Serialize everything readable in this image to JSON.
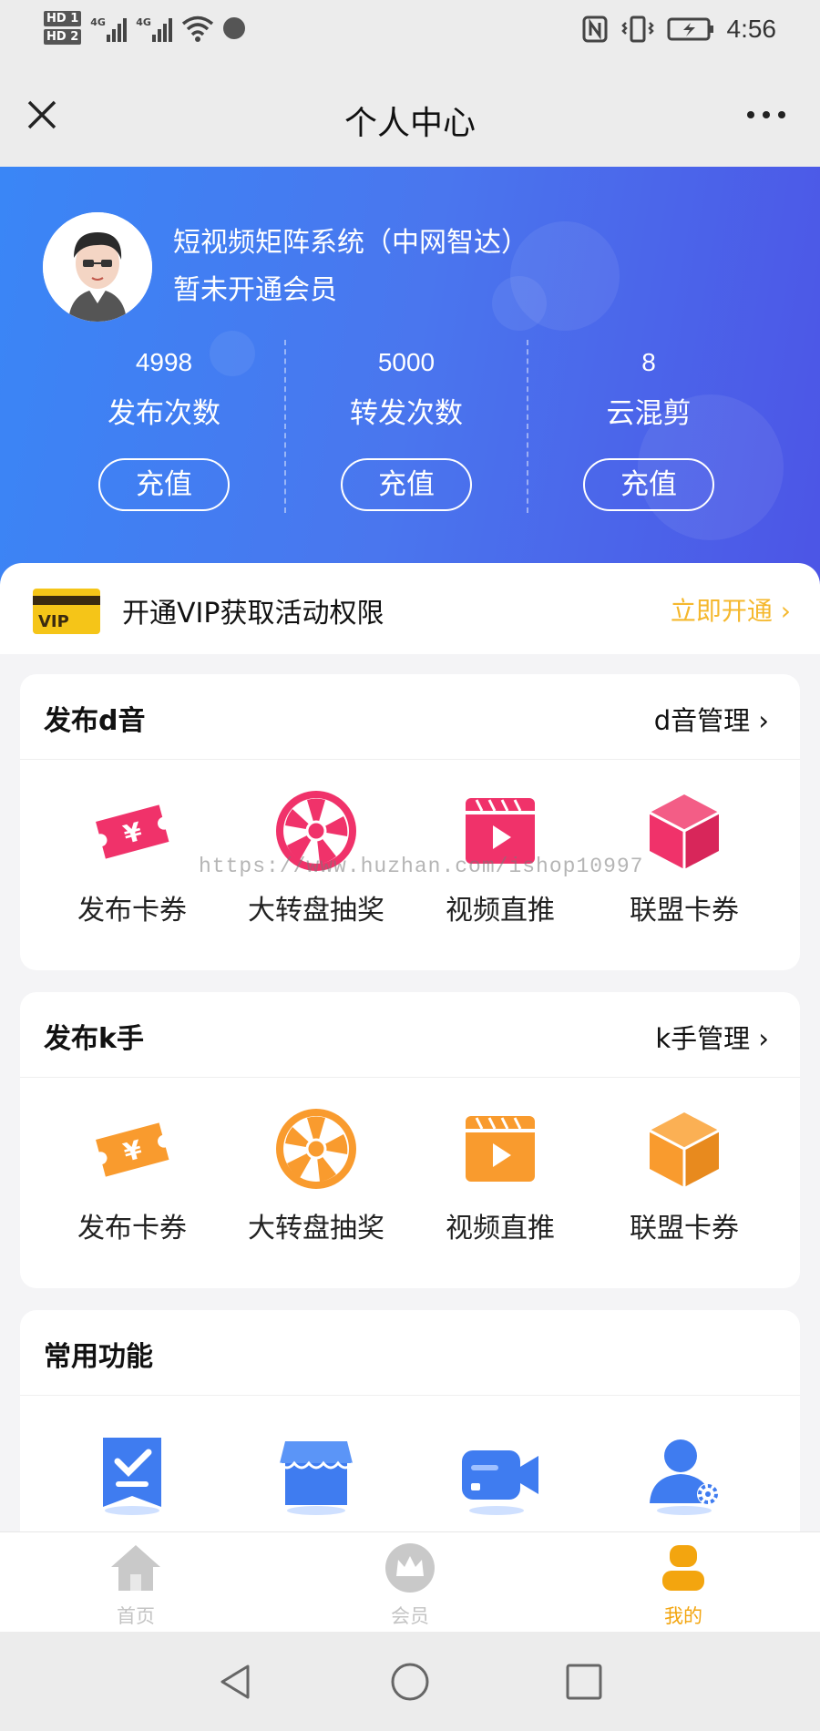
{
  "status_bar": {
    "hd1": "HD 1",
    "hd2": "HD 2",
    "net1": "4G",
    "net2": "4G",
    "time": "4:56"
  },
  "header": {
    "title": "个人中心"
  },
  "profile": {
    "nickname": "短视频矩阵系统（中网智达）",
    "membership": "暂未开通会员",
    "stats": [
      {
        "value": "4998",
        "label": "发布次数",
        "button": "充值"
      },
      {
        "value": "5000",
        "label": "转发次数",
        "button": "充值"
      },
      {
        "value": "8",
        "label": "云混剪",
        "button": "充值"
      }
    ]
  },
  "vip": {
    "badge": "VIP",
    "text": "开通VIP获取活动权限",
    "action": "立即开通 ›"
  },
  "sections": [
    {
      "title": "发布d音",
      "manage": "d音管理 ›",
      "accent": "#f0326a",
      "items": [
        {
          "label": "发布卡券",
          "icon": "coupon-icon"
        },
        {
          "label": "大转盘抽奖",
          "icon": "wheel-icon"
        },
        {
          "label": "视频直推",
          "icon": "video-icon"
        },
        {
          "label": "联盟卡券",
          "icon": "box-icon"
        }
      ]
    },
    {
      "title": "发布k手",
      "manage": "k手管理 ›",
      "accent": "#f99b2e",
      "items": [
        {
          "label": "发布卡券",
          "icon": "coupon-icon"
        },
        {
          "label": "大转盘抽奖",
          "icon": "wheel-icon"
        },
        {
          "label": "视频直推",
          "icon": "video-icon"
        },
        {
          "label": "联盟卡券",
          "icon": "box-icon"
        }
      ]
    },
    {
      "title": "常用功能",
      "accent": "#3f7cf0",
      "items": [
        {
          "icon": "task-icon"
        },
        {
          "icon": "shop-icon"
        },
        {
          "icon": "camera-icon"
        },
        {
          "icon": "user-settings-icon"
        }
      ]
    }
  ],
  "watermark": "https://www.huzhan.com/ishop10997",
  "tabbar": {
    "active_color": "#f3a50f",
    "items": [
      {
        "label": "首页",
        "icon": "home-icon"
      },
      {
        "label": "会员",
        "icon": "crown-icon"
      },
      {
        "label": "我的",
        "icon": "profile-icon"
      }
    ]
  }
}
